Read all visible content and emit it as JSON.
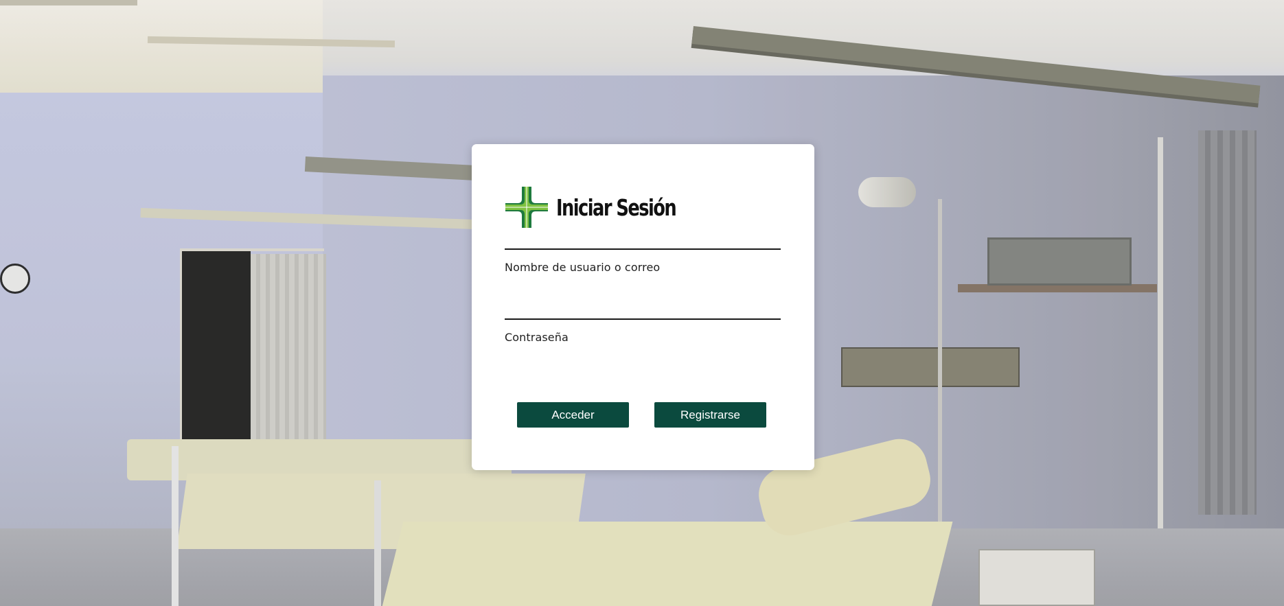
{
  "page": {
    "title": "Iniciar Sesión"
  },
  "login": {
    "title": "Iniciar Sesión",
    "logo_icon": "medical-cross-icon",
    "username": {
      "label": "Nombre de usuario o correo",
      "value": "",
      "placeholder": ""
    },
    "password": {
      "label": "Contraseña",
      "value": "",
      "placeholder": ""
    },
    "buttons": {
      "login_label": "Acceder",
      "register_label": "Registrarse"
    }
  },
  "theme": {
    "accent": "#0b4a3e",
    "logo_dark_green": "#1e7a3e",
    "logo_light_green": "#7fc241",
    "card_background": "#ffffff"
  }
}
